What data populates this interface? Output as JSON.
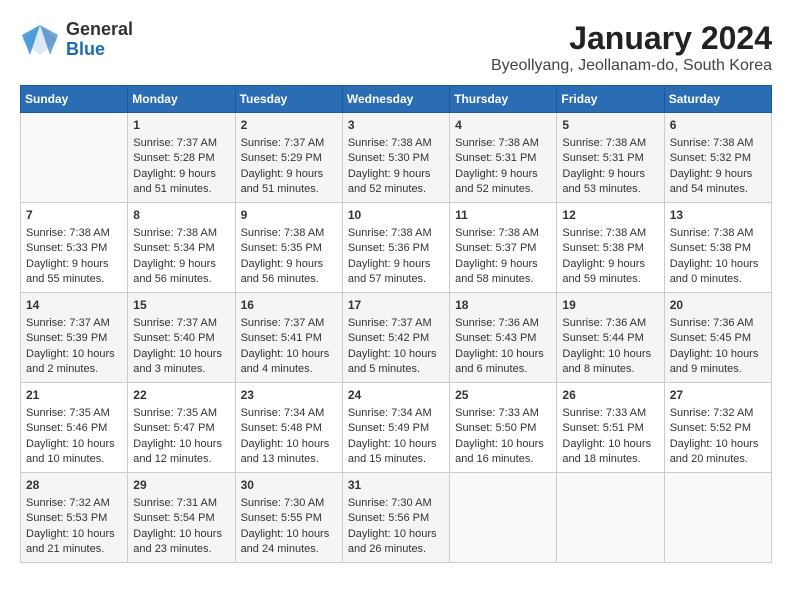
{
  "logo": {
    "general": "General",
    "blue": "Blue"
  },
  "title": "January 2024",
  "subtitle": "Byeollyang, Jeollanam-do, South Korea",
  "days": [
    "Sunday",
    "Monday",
    "Tuesday",
    "Wednesday",
    "Thursday",
    "Friday",
    "Saturday"
  ],
  "weeks": [
    [
      {
        "num": "",
        "info": ""
      },
      {
        "num": "1",
        "info": "Sunrise: 7:37 AM\nSunset: 5:28 PM\nDaylight: 9 hours\nand 51 minutes."
      },
      {
        "num": "2",
        "info": "Sunrise: 7:37 AM\nSunset: 5:29 PM\nDaylight: 9 hours\nand 51 minutes."
      },
      {
        "num": "3",
        "info": "Sunrise: 7:38 AM\nSunset: 5:30 PM\nDaylight: 9 hours\nand 52 minutes."
      },
      {
        "num": "4",
        "info": "Sunrise: 7:38 AM\nSunset: 5:31 PM\nDaylight: 9 hours\nand 52 minutes."
      },
      {
        "num": "5",
        "info": "Sunrise: 7:38 AM\nSunset: 5:31 PM\nDaylight: 9 hours\nand 53 minutes."
      },
      {
        "num": "6",
        "info": "Sunrise: 7:38 AM\nSunset: 5:32 PM\nDaylight: 9 hours\nand 54 minutes."
      }
    ],
    [
      {
        "num": "7",
        "info": "Sunrise: 7:38 AM\nSunset: 5:33 PM\nDaylight: 9 hours\nand 55 minutes."
      },
      {
        "num": "8",
        "info": "Sunrise: 7:38 AM\nSunset: 5:34 PM\nDaylight: 9 hours\nand 56 minutes."
      },
      {
        "num": "9",
        "info": "Sunrise: 7:38 AM\nSunset: 5:35 PM\nDaylight: 9 hours\nand 56 minutes."
      },
      {
        "num": "10",
        "info": "Sunrise: 7:38 AM\nSunset: 5:36 PM\nDaylight: 9 hours\nand 57 minutes."
      },
      {
        "num": "11",
        "info": "Sunrise: 7:38 AM\nSunset: 5:37 PM\nDaylight: 9 hours\nand 58 minutes."
      },
      {
        "num": "12",
        "info": "Sunrise: 7:38 AM\nSunset: 5:38 PM\nDaylight: 9 hours\nand 59 minutes."
      },
      {
        "num": "13",
        "info": "Sunrise: 7:38 AM\nSunset: 5:38 PM\nDaylight: 10 hours\nand 0 minutes."
      }
    ],
    [
      {
        "num": "14",
        "info": "Sunrise: 7:37 AM\nSunset: 5:39 PM\nDaylight: 10 hours\nand 2 minutes."
      },
      {
        "num": "15",
        "info": "Sunrise: 7:37 AM\nSunset: 5:40 PM\nDaylight: 10 hours\nand 3 minutes."
      },
      {
        "num": "16",
        "info": "Sunrise: 7:37 AM\nSunset: 5:41 PM\nDaylight: 10 hours\nand 4 minutes."
      },
      {
        "num": "17",
        "info": "Sunrise: 7:37 AM\nSunset: 5:42 PM\nDaylight: 10 hours\nand 5 minutes."
      },
      {
        "num": "18",
        "info": "Sunrise: 7:36 AM\nSunset: 5:43 PM\nDaylight: 10 hours\nand 6 minutes."
      },
      {
        "num": "19",
        "info": "Sunrise: 7:36 AM\nSunset: 5:44 PM\nDaylight: 10 hours\nand 8 minutes."
      },
      {
        "num": "20",
        "info": "Sunrise: 7:36 AM\nSunset: 5:45 PM\nDaylight: 10 hours\nand 9 minutes."
      }
    ],
    [
      {
        "num": "21",
        "info": "Sunrise: 7:35 AM\nSunset: 5:46 PM\nDaylight: 10 hours\nand 10 minutes."
      },
      {
        "num": "22",
        "info": "Sunrise: 7:35 AM\nSunset: 5:47 PM\nDaylight: 10 hours\nand 12 minutes."
      },
      {
        "num": "23",
        "info": "Sunrise: 7:34 AM\nSunset: 5:48 PM\nDaylight: 10 hours\nand 13 minutes."
      },
      {
        "num": "24",
        "info": "Sunrise: 7:34 AM\nSunset: 5:49 PM\nDaylight: 10 hours\nand 15 minutes."
      },
      {
        "num": "25",
        "info": "Sunrise: 7:33 AM\nSunset: 5:50 PM\nDaylight: 10 hours\nand 16 minutes."
      },
      {
        "num": "26",
        "info": "Sunrise: 7:33 AM\nSunset: 5:51 PM\nDaylight: 10 hours\nand 18 minutes."
      },
      {
        "num": "27",
        "info": "Sunrise: 7:32 AM\nSunset: 5:52 PM\nDaylight: 10 hours\nand 20 minutes."
      }
    ],
    [
      {
        "num": "28",
        "info": "Sunrise: 7:32 AM\nSunset: 5:53 PM\nDaylight: 10 hours\nand 21 minutes."
      },
      {
        "num": "29",
        "info": "Sunrise: 7:31 AM\nSunset: 5:54 PM\nDaylight: 10 hours\nand 23 minutes."
      },
      {
        "num": "30",
        "info": "Sunrise: 7:30 AM\nSunset: 5:55 PM\nDaylight: 10 hours\nand 24 minutes."
      },
      {
        "num": "31",
        "info": "Sunrise: 7:30 AM\nSunset: 5:56 PM\nDaylight: 10 hours\nand 26 minutes."
      },
      {
        "num": "",
        "info": ""
      },
      {
        "num": "",
        "info": ""
      },
      {
        "num": "",
        "info": ""
      }
    ]
  ]
}
